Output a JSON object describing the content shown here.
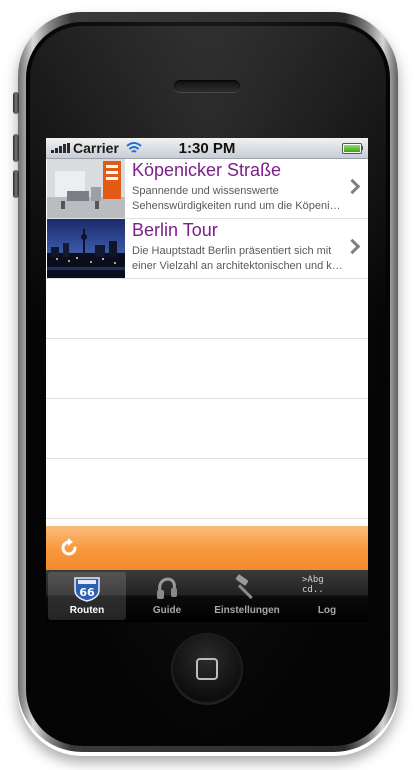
{
  "status_bar": {
    "carrier": "Carrier",
    "time": "1:30 PM"
  },
  "routes": [
    {
      "title": "Köpenicker Straße",
      "description_line1": "Spannende und wissenswerte",
      "description_line2": "Sehenswürdigkeiten rund um die Köpenicker Straße",
      "thumbnail": "exhibition-stand-photo"
    },
    {
      "title": "Berlin Tour",
      "description_line1": "Die Hauptstadt Berlin präsentiert sich mit",
      "description_line2": "einer Vielzahl an architektonischen und kulturellen",
      "thumbnail": "berlin-skyline-night-photo"
    }
  ],
  "toolbar": {
    "refresh_icon": "refresh-icon",
    "accent_color": "#f7973d"
  },
  "tabs": [
    {
      "label": "Routen",
      "icon": "route-66-icon",
      "active": true
    },
    {
      "label": "Guide",
      "icon": "headphones-icon",
      "active": false
    },
    {
      "label": "Einstellungen",
      "icon": "hammer-icon",
      "active": false
    },
    {
      "label": "Log",
      "icon": "terminal-log-icon",
      "active": false,
      "icon_text": ">Abg\ncd.."
    }
  ],
  "colors": {
    "title_purple": "#7c1f8a",
    "tab_bar": "#1a1a1a"
  }
}
